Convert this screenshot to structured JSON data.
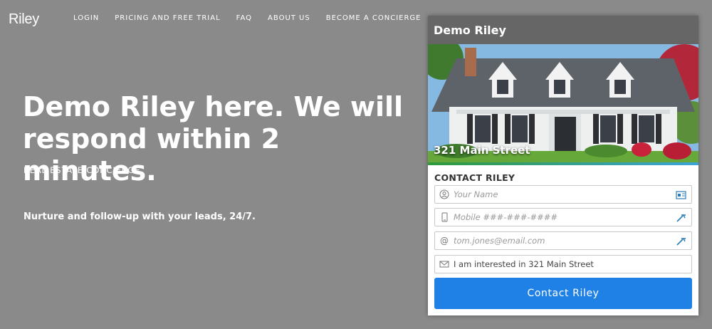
{
  "brand": {
    "logo": "Riley"
  },
  "nav": {
    "items": [
      {
        "label": "LOGIN"
      },
      {
        "label": "PRICING AND FREE TRIAL"
      },
      {
        "label": "FAQ"
      },
      {
        "label": "ABOUT US"
      },
      {
        "label": "BECOME A CONCIERGE"
      }
    ]
  },
  "hero": {
    "title": "Demo Riley here. We will respond within 2 minutes.",
    "subtitle": "REAL ESTATE CONCIERGE",
    "tagline": "Nurture and follow-up with your leads, 24/7."
  },
  "card": {
    "header": "Demo Riley",
    "property_address": "321 Main Street",
    "contact_title": "CONTACT RILEY",
    "name_placeholder": "Your Name",
    "mobile_placeholder": "Mobile ###-###-####",
    "email_placeholder": "tom.jones@email.com",
    "message_value": "I am interested in 321 Main Street",
    "submit_label": "Contact Riley"
  },
  "colors": {
    "page_bg": "#8a8a8a",
    "card_header_bg": "#666666",
    "button": "#1f80e6"
  },
  "icons": {
    "name": "user-icon",
    "mobile": "phone-icon",
    "email": "at-icon",
    "message": "envelope-icon",
    "autofill": "autofill-key-icon"
  }
}
